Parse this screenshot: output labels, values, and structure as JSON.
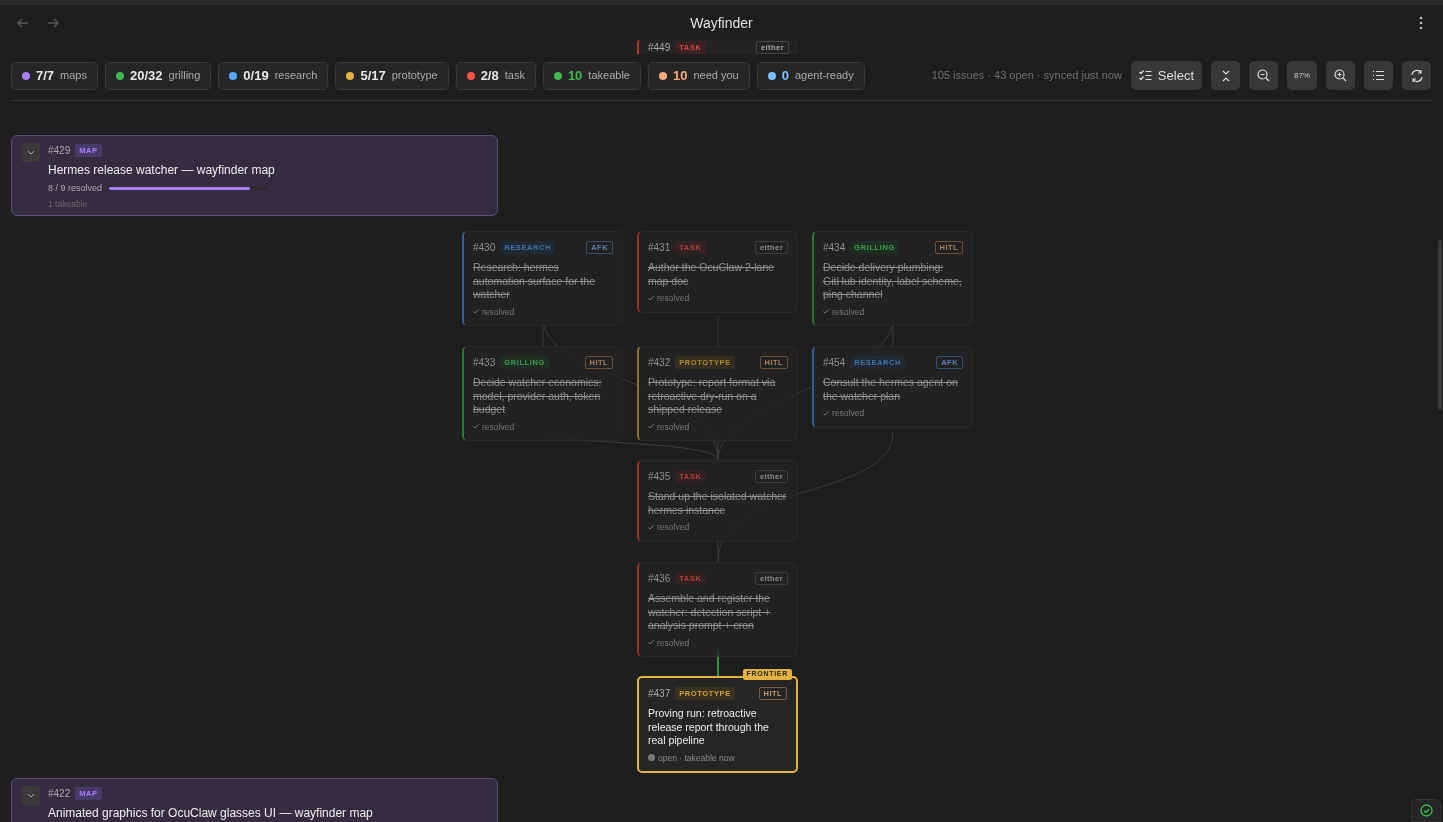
{
  "window": {
    "title": "Wayfinder"
  },
  "chips": [
    {
      "count": "7/7",
      "label": "maps",
      "color": "#a87ef5",
      "accent": false
    },
    {
      "count": "20/32",
      "label": "grilling",
      "color": "#3fb950",
      "accent": false
    },
    {
      "count": "0/19",
      "label": "research",
      "color": "#58a6ff",
      "accent": false
    },
    {
      "count": "5/17",
      "label": "prototype",
      "color": "#e3b341",
      "accent": false
    },
    {
      "count": "2/8",
      "label": "task",
      "color": "#f85149",
      "accent": false
    },
    {
      "count": "10",
      "label": "takeable",
      "color": "#3fb950",
      "accent": true
    },
    {
      "count": "10",
      "label": "need you",
      "color": "#f5a97f",
      "accent": true
    },
    {
      "count": "0",
      "label": "agent-ready",
      "color": "#79c0ff",
      "accent": true
    }
  ],
  "sync_status": "105 issues · 43 open · synced just now",
  "toolbar": {
    "select": "Select",
    "zoom": "87%"
  },
  "maps": [
    {
      "number": "#429",
      "tag": "MAP",
      "title": "Hermes release watcher — wayfinder map",
      "progress_text": "8 / 9 resolved",
      "level": 0.89,
      "takeable": "1 takeable"
    },
    {
      "number": "#422",
      "tag": "MAP",
      "title": "Animated graphics for OcuClaw glasses UI — wayfinder map"
    }
  ],
  "nodes": [
    {
      "number": "#449",
      "kind": "task",
      "tag": "TASK",
      "agent": "either"
    },
    {
      "number": "#430",
      "kind": "research",
      "tag": "RESEARCH",
      "agent": "AFK",
      "title": "Research: hermes automation surface for the watcher",
      "status": "resolved",
      "resolved": true,
      "frontier": false
    },
    {
      "number": "#431",
      "kind": "task",
      "tag": "TASK",
      "agent": "either",
      "title": "Author the OcuClaw 2-lane map doc",
      "status": "resolved",
      "resolved": true,
      "frontier": false
    },
    {
      "number": "#434",
      "kind": "grilling",
      "tag": "GRILLING",
      "agent": "HITL",
      "title": "Decide delivery plumbing: GitHub identity, label scheme, ping channel",
      "status": "resolved",
      "resolved": true,
      "frontier": false
    },
    {
      "number": "#433",
      "kind": "grilling",
      "tag": "GRILLING",
      "agent": "HITL",
      "title": "Decide watcher economics: model, provider auth, token budget",
      "status": "resolved",
      "resolved": true,
      "frontier": false
    },
    {
      "number": "#432",
      "kind": "prototype",
      "tag": "PROTOTYPE",
      "agent": "HITL",
      "title": "Prototype: report format via retroactive dry-run on a shipped release",
      "status": "resolved",
      "resolved": true,
      "frontier": false
    },
    {
      "number": "#454",
      "kind": "research",
      "tag": "RESEARCH",
      "agent": "AFK",
      "title": "Consult the hermes agent on the watcher plan",
      "status": "resolved",
      "resolved": true,
      "frontier": false
    },
    {
      "number": "#435",
      "kind": "task",
      "tag": "TASK",
      "agent": "either",
      "title": "Stand up the isolated watcher hermes instance",
      "status": "resolved",
      "resolved": true,
      "frontier": false
    },
    {
      "number": "#436",
      "kind": "task",
      "tag": "TASK",
      "agent": "either",
      "title": "Assemble and register the watcher: detection script + analysis prompt + cron",
      "status": "resolved",
      "resolved": true,
      "frontier": false
    },
    {
      "number": "#437",
      "kind": "prototype",
      "tag": "PROTOTYPE",
      "agent": "HITL",
      "title": "Proving run: retroactive release report through the real pipeline",
      "status": "open · takeable now",
      "resolved": false,
      "frontier": true,
      "frontier_label": "FRONTIER"
    }
  ]
}
